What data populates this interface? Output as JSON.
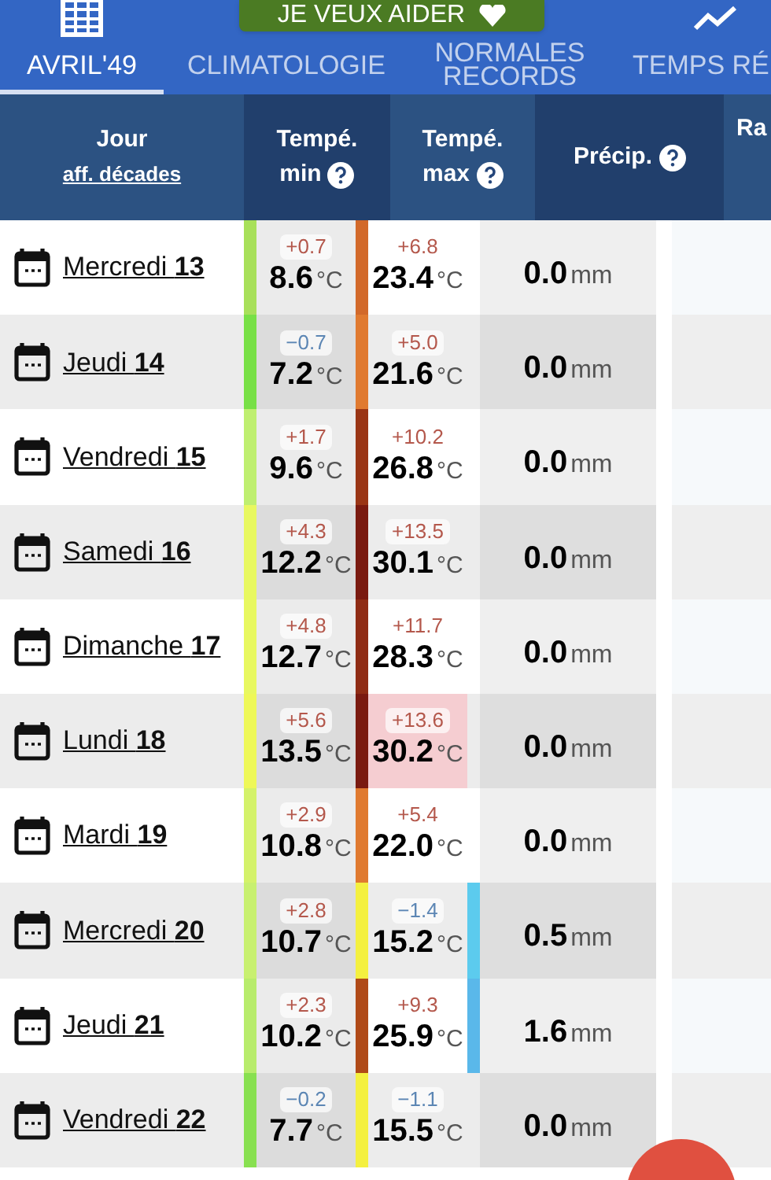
{
  "help_button": {
    "label": "JE VEUX AIDER"
  },
  "tabs": [
    {
      "label": "AVRIL'49",
      "selected": true
    },
    {
      "label": "CLIMATOLOGIE",
      "selected": false
    },
    {
      "label": "NORMALES RECORDS",
      "selected": false
    },
    {
      "label": "TEMPS RÉ",
      "selected": false
    }
  ],
  "columns": [
    {
      "kind": "day",
      "title": "Jour",
      "link": "aff. décades"
    },
    {
      "kind": "min",
      "title": "Tempé.",
      "subtitle": "min",
      "help": true
    },
    {
      "kind": "max",
      "title": "Tempé.",
      "subtitle": "max",
      "help": true
    },
    {
      "kind": "precip",
      "title": "Précip.",
      "help": true
    },
    {
      "kind": "cut",
      "title": "Ra"
    }
  ],
  "rows": [
    {
      "weekday": "Mercredi",
      "day": "13",
      "min": {
        "delta": "+0.7",
        "kind": "above",
        "value": "8.6",
        "unit": "°C",
        "color": "#a8e05a"
      },
      "max": {
        "delta": "+6.8",
        "kind": "above",
        "value": "23.4",
        "unit": "°C",
        "color": "#d2692a",
        "highlight": false
      },
      "precip": {
        "value": "0.0",
        "unit": "mm"
      }
    },
    {
      "weekday": "Jeudi",
      "day": "14",
      "min": {
        "delta": "−0.7",
        "kind": "below",
        "value": "7.2",
        "unit": "°C",
        "color": "#78e046"
      },
      "max": {
        "delta": "+5.0",
        "kind": "above",
        "value": "21.6",
        "unit": "°C",
        "color": "#e07a30",
        "highlight": false
      },
      "precip": {
        "value": "0.0",
        "unit": "mm"
      }
    },
    {
      "weekday": "Vendredi",
      "day": "15",
      "min": {
        "delta": "+1.7",
        "kind": "above",
        "value": "9.6",
        "unit": "°C",
        "color": "#bfef70"
      },
      "max": {
        "delta": "+10.2",
        "kind": "above",
        "value": "26.8",
        "unit": "°C",
        "color": "#9a3515",
        "highlight": false
      },
      "precip": {
        "value": "0.0",
        "unit": "mm"
      }
    },
    {
      "weekday": "Samedi",
      "day": "16",
      "min": {
        "delta": "+4.3",
        "kind": "above",
        "value": "12.2",
        "unit": "°C",
        "color": "#e8f860"
      },
      "max": {
        "delta": "+13.5",
        "kind": "above",
        "value": "30.1",
        "unit": "°C",
        "color": "#7a1a10",
        "highlight": false
      },
      "precip": {
        "value": "0.0",
        "unit": "mm"
      }
    },
    {
      "weekday": "Dimanche",
      "day": "17",
      "min": {
        "delta": "+4.8",
        "kind": "above",
        "value": "12.7",
        "unit": "°C",
        "color": "#e8f860"
      },
      "max": {
        "delta": "+11.7",
        "kind": "above",
        "value": "28.3",
        "unit": "°C",
        "color": "#8f2c14",
        "highlight": false
      },
      "precip": {
        "value": "0.0",
        "unit": "mm"
      }
    },
    {
      "weekday": "Lundi",
      "day": "18",
      "min": {
        "delta": "+5.6",
        "kind": "above",
        "value": "13.5",
        "unit": "°C",
        "color": "#eef858"
      },
      "max": {
        "delta": "+13.6",
        "kind": "above",
        "value": "30.2",
        "unit": "°C",
        "color": "#7a1a10",
        "highlight": true
      },
      "precip": {
        "value": "0.0",
        "unit": "mm"
      }
    },
    {
      "weekday": "Mardi",
      "day": "19",
      "min": {
        "delta": "+2.9",
        "kind": "above",
        "value": "10.8",
        "unit": "°C",
        "color": "#d4f26a"
      },
      "max": {
        "delta": "+5.4",
        "kind": "above",
        "value": "22.0",
        "unit": "°C",
        "color": "#e07a30",
        "highlight": false
      },
      "precip": {
        "value": "0.0",
        "unit": "mm"
      }
    },
    {
      "weekday": "Mercredi",
      "day": "20",
      "min": {
        "delta": "+2.8",
        "kind": "above",
        "value": "10.7",
        "unit": "°C",
        "color": "#c8f070"
      },
      "max": {
        "delta": "−1.4",
        "kind": "below",
        "value": "15.2",
        "unit": "°C",
        "color": "#f4f040",
        "highlight": false
      },
      "precip": {
        "value": "0.5",
        "unit": "mm",
        "color": "#5ccbee"
      }
    },
    {
      "weekday": "Jeudi",
      "day": "21",
      "min": {
        "delta": "+2.3",
        "kind": "above",
        "value": "10.2",
        "unit": "°C",
        "color": "#b8ec6c"
      },
      "max": {
        "delta": "+9.3",
        "kind": "above",
        "value": "25.9",
        "unit": "°C",
        "color": "#b04a18",
        "highlight": false
      },
      "precip": {
        "value": "1.6",
        "unit": "mm",
        "color": "#5ab8ea"
      }
    },
    {
      "weekday": "Vendredi",
      "day": "22",
      "min": {
        "delta": "−0.2",
        "kind": "below",
        "value": "7.7",
        "unit": "°C",
        "color": "#88e050"
      },
      "max": {
        "delta": "−1.1",
        "kind": "below",
        "value": "15.5",
        "unit": "°C",
        "color": "#f4f040",
        "highlight": false
      },
      "precip": {
        "value": "0.0",
        "unit": "mm"
      }
    }
  ]
}
